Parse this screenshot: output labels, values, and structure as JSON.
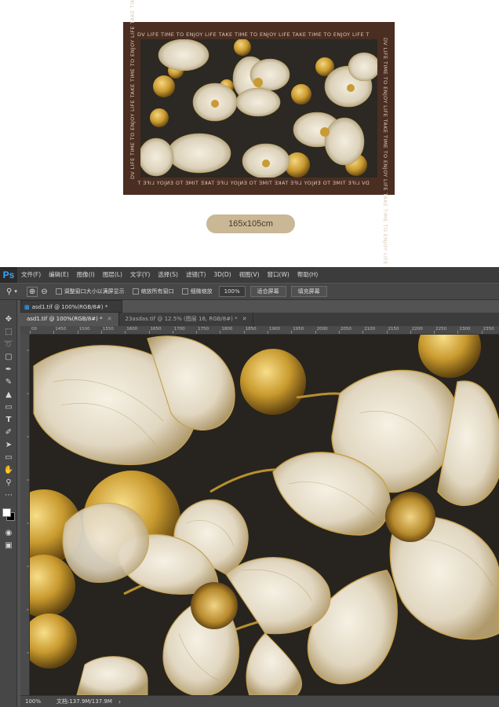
{
  "preview": {
    "border_text": "DV LIFE TIME TO ENJOY LIFE TAKE TIME TO ENJOY LIFE TAKE TIME TO ENJOY LIFE T",
    "size_label": "165x105cm",
    "colors": {
      "frame": "#4a2e22",
      "pill": "#c9b795",
      "gold": "#c99a2e",
      "cream": "#ece4d0"
    }
  },
  "photoshop": {
    "logo": "Ps",
    "menu": [
      "文件(F)",
      "编辑(E)",
      "图像(I)",
      "图层(L)",
      "文字(Y)",
      "选择(S)",
      "滤镜(T)",
      "3D(D)",
      "视图(V)",
      "窗口(W)",
      "帮助(H)"
    ],
    "options": {
      "resize_windows_label": "调整窗口大小以满屏显示",
      "zoom_all_label": "缩放所有窗口",
      "scrubby_zoom_label": "细微缩放",
      "zoom_value": "100%",
      "fit_screen_label": "适合屏幕",
      "fill_screen_label": "填充屏幕"
    },
    "doc_title": "asd1.tif @ 100%(RGB/8#) *",
    "tabs": [
      {
        "label": "asd1.tif @ 100%(RGB/8#) *",
        "active": true
      },
      {
        "label": "23asdas.tif @ 12.5% (图层 16, RGB/8#) *",
        "active": false
      }
    ],
    "ruler_labels": [
      "00",
      "1450",
      "1500",
      "1550",
      "1600",
      "1650",
      "1700",
      "1750",
      "1800",
      "1850",
      "1900",
      "1950",
      "2000",
      "2050",
      "2100",
      "2150",
      "2200",
      "2250",
      "2300",
      "2350"
    ],
    "status": {
      "zoom": "100%",
      "doc_size": "文档:137.9M/137.9M"
    }
  }
}
